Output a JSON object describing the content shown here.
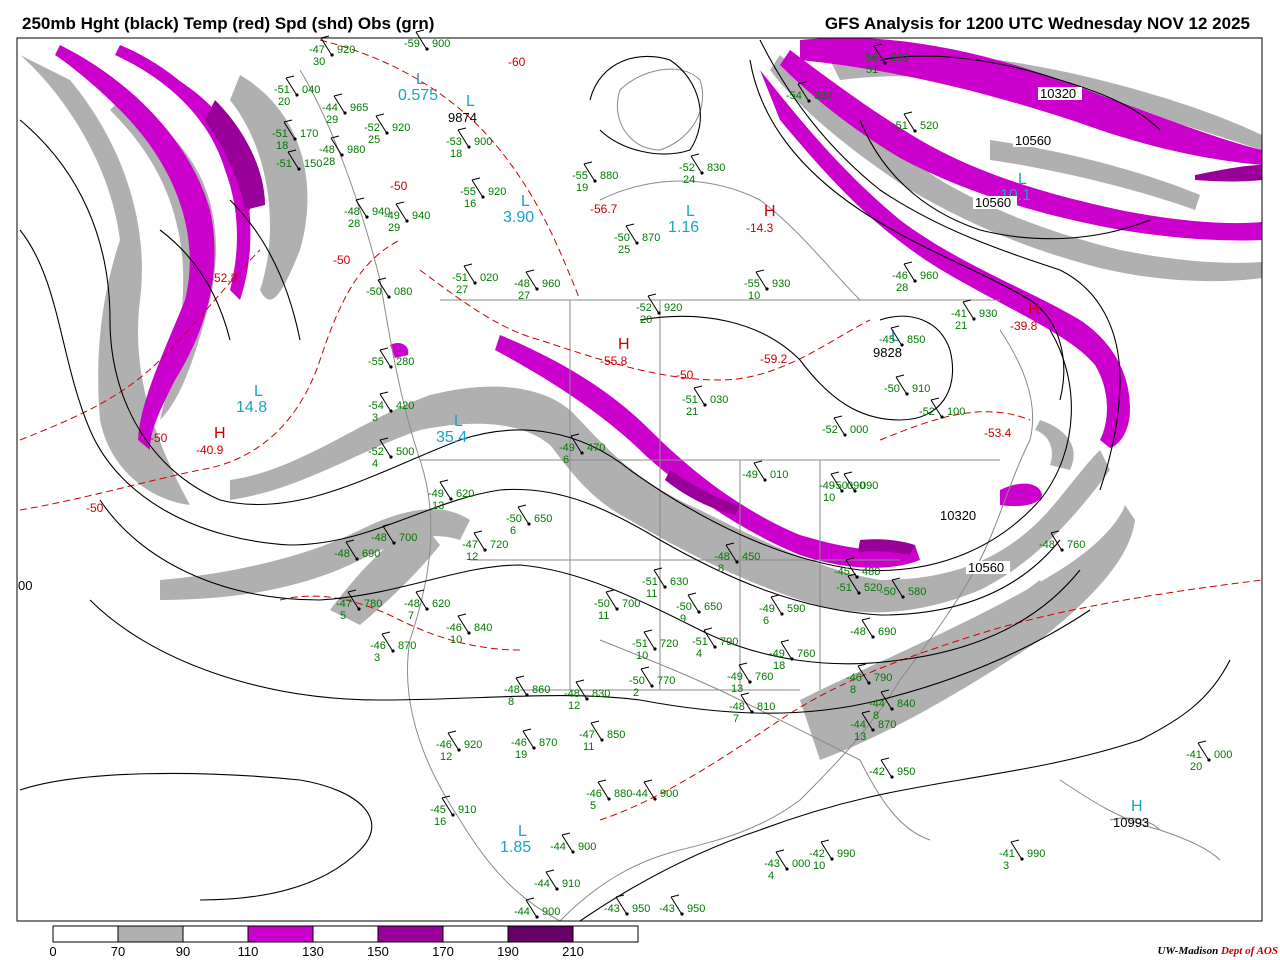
{
  "header": {
    "title_left": "250mb Hght (black) Temp (red) Spd (shd) Obs (grn)",
    "title_right": "GFS Analysis for 1200 UTC Wednesday  NOV 12 2025"
  },
  "colors": {
    "height": "#000000",
    "temperature": "#cc0000",
    "obs": "#007a00",
    "pressure_centers": "#1aa3c8",
    "map_lines": "#8a8a8a",
    "speed_70_90": "#b0b0b0",
    "speed_110_130": "#cc00cc",
    "speed_150_170": "#990099",
    "speed_190_210": "#660066"
  },
  "legend": {
    "ticks": [
      "0",
      "70",
      "90",
      "110",
      "130",
      "150",
      "170",
      "190",
      "210"
    ],
    "fills": [
      "#ffffff",
      "#b0b0b0",
      "#ffffff",
      "#cc00cc",
      "#ffffff",
      "#990099",
      "#ffffff",
      "#660066",
      "#ffffff"
    ]
  },
  "centers": [
    {
      "label": "L",
      "value": "0.575",
      "kind": "low"
    },
    {
      "label": "L",
      "value": "3.90",
      "kind": "low"
    },
    {
      "label": "L",
      "value": "1.16",
      "kind": "low"
    },
    {
      "label": "L",
      "value": "14.8",
      "kind": "low"
    },
    {
      "label": "L",
      "value": "35.4",
      "kind": "low"
    },
    {
      "label": "L",
      "value": "1.85",
      "kind": "low"
    },
    {
      "label": "L",
      "value": "10.1",
      "kind": "low"
    },
    {
      "label": "H",
      "value": "-40.9",
      "kind": "high-temp"
    },
    {
      "label": "H",
      "value": "-55.8",
      "kind": "high-temp"
    },
    {
      "label": "H",
      "value": "-14.3",
      "kind": "high-temp"
    },
    {
      "label": "H",
      "value": "-39.8",
      "kind": "high-temp"
    },
    {
      "label": "L",
      "value": "9828",
      "kind": "height-low"
    },
    {
      "label": "L",
      "value": "9874",
      "kind": "height-low"
    },
    {
      "label": "H",
      "value": "10993",
      "kind": "height-high"
    }
  ],
  "height_labels": [
    "10320",
    "10560",
    "10560",
    "10320",
    "10560",
    "00"
  ],
  "temp_labels": [
    "-60",
    "-50",
    "-50",
    "-50",
    "-52.8",
    "-56.7",
    "-59.2",
    "-53.4",
    "-50",
    "-50"
  ],
  "observations": [
    {
      "t": "-47",
      "h": "920",
      "d": "30"
    },
    {
      "t": "-59",
      "h": "900",
      "d": ""
    },
    {
      "t": "-51",
      "h": "040",
      "d": "20"
    },
    {
      "t": "-44",
      "h": "965",
      "d": "29"
    },
    {
      "t": "-52",
      "h": "920",
      "d": "25"
    },
    {
      "t": "-53",
      "h": "900",
      "d": "18"
    },
    {
      "t": "-51",
      "h": "170",
      "d": "18"
    },
    {
      "t": "-48",
      "h": "980",
      "d": "28"
    },
    {
      "t": "-51",
      "h": "150",
      "d": ""
    },
    {
      "t": "-55",
      "h": "920",
      "d": "16"
    },
    {
      "t": "-55",
      "h": "880",
      "d": "19"
    },
    {
      "t": "-52",
      "h": "830",
      "d": "24"
    },
    {
      "t": "-48",
      "h": "940",
      "d": "28"
    },
    {
      "t": "-49",
      "h": "940",
      "d": "29"
    },
    {
      "t": "-50",
      "h": "870",
      "d": "25"
    },
    {
      "t": "-51",
      "h": "020",
      "d": "27"
    },
    {
      "t": "-48",
      "h": "960",
      "d": "27"
    },
    {
      "t": "-55",
      "h": "930",
      "d": "10"
    },
    {
      "t": "-56",
      "h": "390",
      "d": "51"
    },
    {
      "t": "-54",
      "h": "330",
      "d": ""
    },
    {
      "t": "-51",
      "h": "520",
      "d": ""
    },
    {
      "t": "-46",
      "h": "960",
      "d": "28"
    },
    {
      "t": "-52",
      "h": "920",
      "d": "20"
    },
    {
      "t": "-50",
      "h": "080",
      "d": ""
    },
    {
      "t": "-45",
      "h": "850",
      "d": ""
    },
    {
      "t": "-41",
      "h": "930",
      "d": "21"
    },
    {
      "t": "-51",
      "h": "030",
      "d": "21"
    },
    {
      "t": "-50",
      "h": "910",
      "d": ""
    },
    {
      "t": "-52",
      "h": "000",
      "d": ""
    },
    {
      "t": "-52",
      "h": "100",
      "d": ""
    },
    {
      "t": "-54",
      "h": "420",
      "d": "3"
    },
    {
      "t": "-52",
      "h": "500",
      "d": "4"
    },
    {
      "t": "-55",
      "h": "280",
      "d": ""
    },
    {
      "t": "-49",
      "h": "470",
      "d": "6"
    },
    {
      "t": "-49",
      "h": "620",
      "d": "13"
    },
    {
      "t": "-50",
      "h": "650",
      "d": "6"
    },
    {
      "t": "-48",
      "h": "700",
      "d": ""
    },
    {
      "t": "-48",
      "h": "690",
      "d": ""
    },
    {
      "t": "-47",
      "h": "720",
      "d": "12"
    },
    {
      "t": "-49",
      "h": "010",
      "d": ""
    },
    {
      "t": "-49",
      "h": "090",
      "d": "10"
    },
    {
      "t": "-50",
      "h": "090",
      "d": ""
    },
    {
      "t": "-47",
      "h": "780",
      "d": "5"
    },
    {
      "t": "-48",
      "h": "620",
      "d": "7"
    },
    {
      "t": "-46",
      "h": "840",
      "d": "10"
    },
    {
      "t": "-51",
      "h": "630",
      "d": "11"
    },
    {
      "t": "-50",
      "h": "700",
      "d": "11"
    },
    {
      "t": "-50",
      "h": "650",
      "d": "9"
    },
    {
      "t": "-49",
      "h": "590",
      "d": "6"
    },
    {
      "t": "-46",
      "h": "870",
      "d": "3"
    },
    {
      "t": "-51",
      "h": "720",
      "d": "10"
    },
    {
      "t": "-51",
      "h": "790",
      "d": "4"
    },
    {
      "t": "-49",
      "h": "760",
      "d": "18"
    },
    {
      "t": "-48",
      "h": "690",
      "d": ""
    },
    {
      "t": "-48",
      "h": "860",
      "d": "8"
    },
    {
      "t": "-48",
      "h": "830",
      "d": "12"
    },
    {
      "t": "-50",
      "h": "770",
      "d": "2"
    },
    {
      "t": "-49",
      "h": "760",
      "d": "13"
    },
    {
      "t": "-46",
      "h": "790",
      "d": "8"
    },
    {
      "t": "-48",
      "h": "810",
      "d": "7"
    },
    {
      "t": "-44",
      "h": "840",
      "d": "8"
    },
    {
      "t": "-44",
      "h": "870",
      "d": "13"
    },
    {
      "t": "-46",
      "h": "920",
      "d": "12"
    },
    {
      "t": "-46",
      "h": "870",
      "d": "19"
    },
    {
      "t": "-47",
      "h": "850",
      "d": "11"
    },
    {
      "t": "-42",
      "h": "950",
      "d": ""
    },
    {
      "t": "-48",
      "h": "760",
      "d": ""
    },
    {
      "t": "-41",
      "h": "000",
      "d": "20"
    },
    {
      "t": "-45",
      "h": "910",
      "d": "16"
    },
    {
      "t": "-46",
      "h": "880",
      "d": "5"
    },
    {
      "t": "-44",
      "h": "900",
      "d": ""
    },
    {
      "t": "-44",
      "h": "900",
      "d": ""
    },
    {
      "t": "-44",
      "h": "910",
      "d": ""
    },
    {
      "t": "-44",
      "h": "900",
      "d": ""
    },
    {
      "t": "-43",
      "h": "950",
      "d": ""
    },
    {
      "t": "-43",
      "h": "950",
      "d": ""
    },
    {
      "t": "-43",
      "h": "000",
      "d": "4"
    },
    {
      "t": "-42",
      "h": "990",
      "d": "10"
    },
    {
      "t": "-41",
      "h": "990",
      "d": "3"
    },
    {
      "t": "-51",
      "h": "520",
      "d": ""
    },
    {
      "t": "-50",
      "h": "580",
      "d": ""
    },
    {
      "t": "-45",
      "h": "480",
      "d": ""
    },
    {
      "t": "-48",
      "h": "450",
      "d": "8"
    }
  ],
  "credit": {
    "org": "UW-Madison",
    "dept": "Dept of AOS"
  }
}
